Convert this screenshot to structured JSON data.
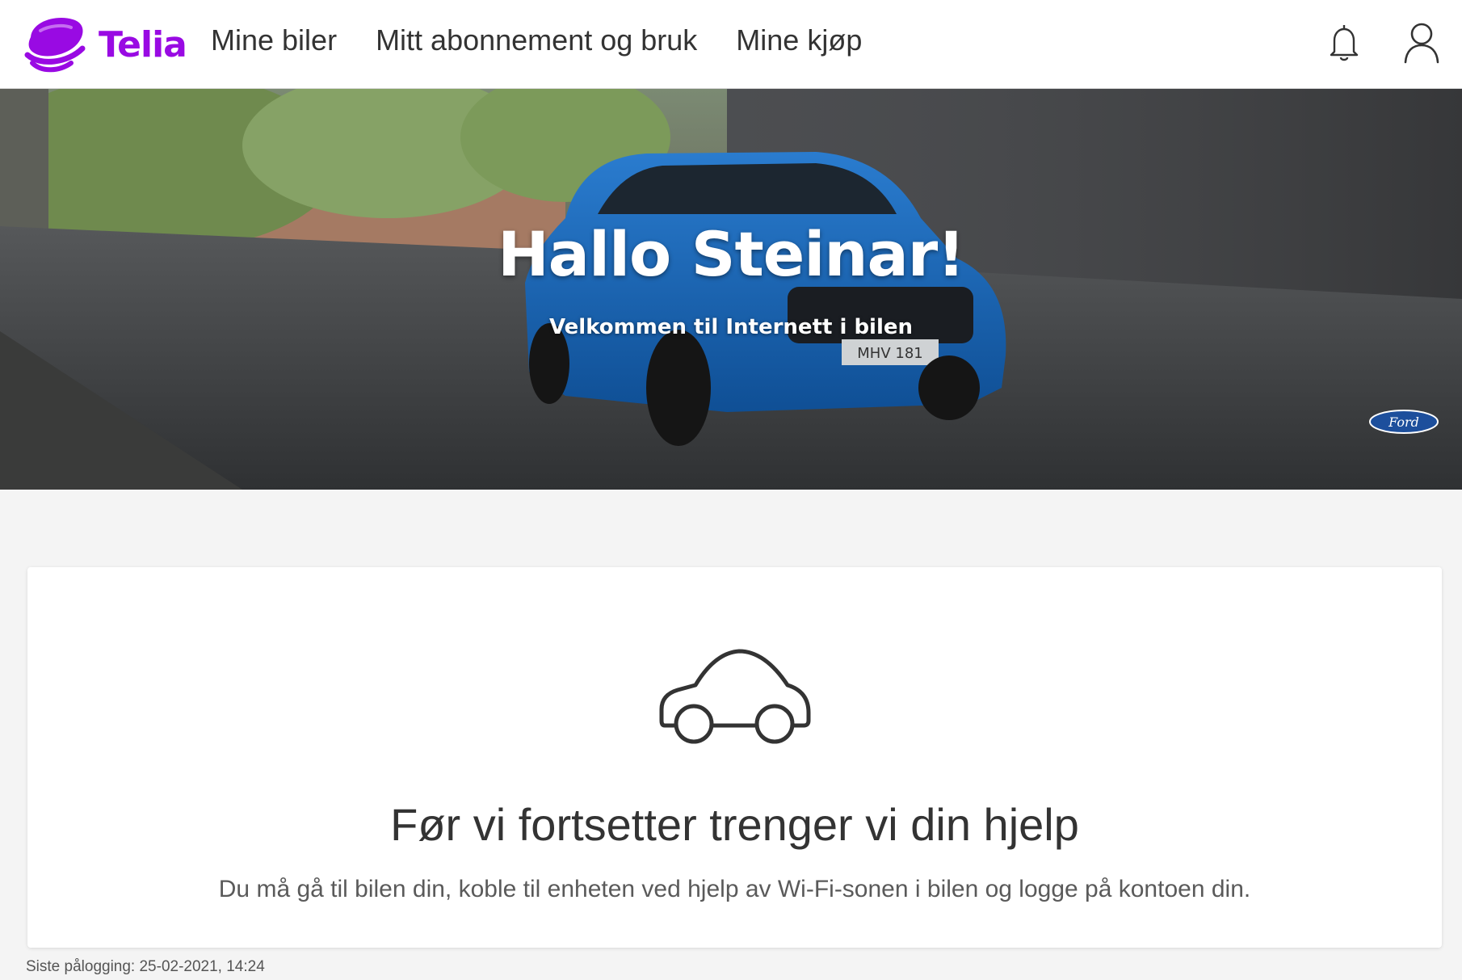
{
  "brand": {
    "name": "Telia",
    "color": "#990ae3"
  },
  "nav": {
    "items": [
      {
        "label": "Mine biler"
      },
      {
        "label": "Mitt abonnement og bruk"
      },
      {
        "label": "Mine kjøp"
      }
    ]
  },
  "header_icons": {
    "notifications": "bell-icon",
    "profile": "user-icon"
  },
  "hero": {
    "title": "Hallo Steinar!",
    "subtitle": "Velkommen til Internett i bilen",
    "plate": "MHV 181",
    "car_brand": "Ford"
  },
  "card": {
    "icon": "car-icon",
    "title": "Før vi fortsetter trenger vi din hjelp",
    "text": "Du må gå til bilen din, koble til enheten ved hjelp av Wi-Fi-sonen i bilen og logge på kontoen din."
  },
  "footer": {
    "last_login": "Siste pålogging: 25-02-2021, 14:24"
  }
}
